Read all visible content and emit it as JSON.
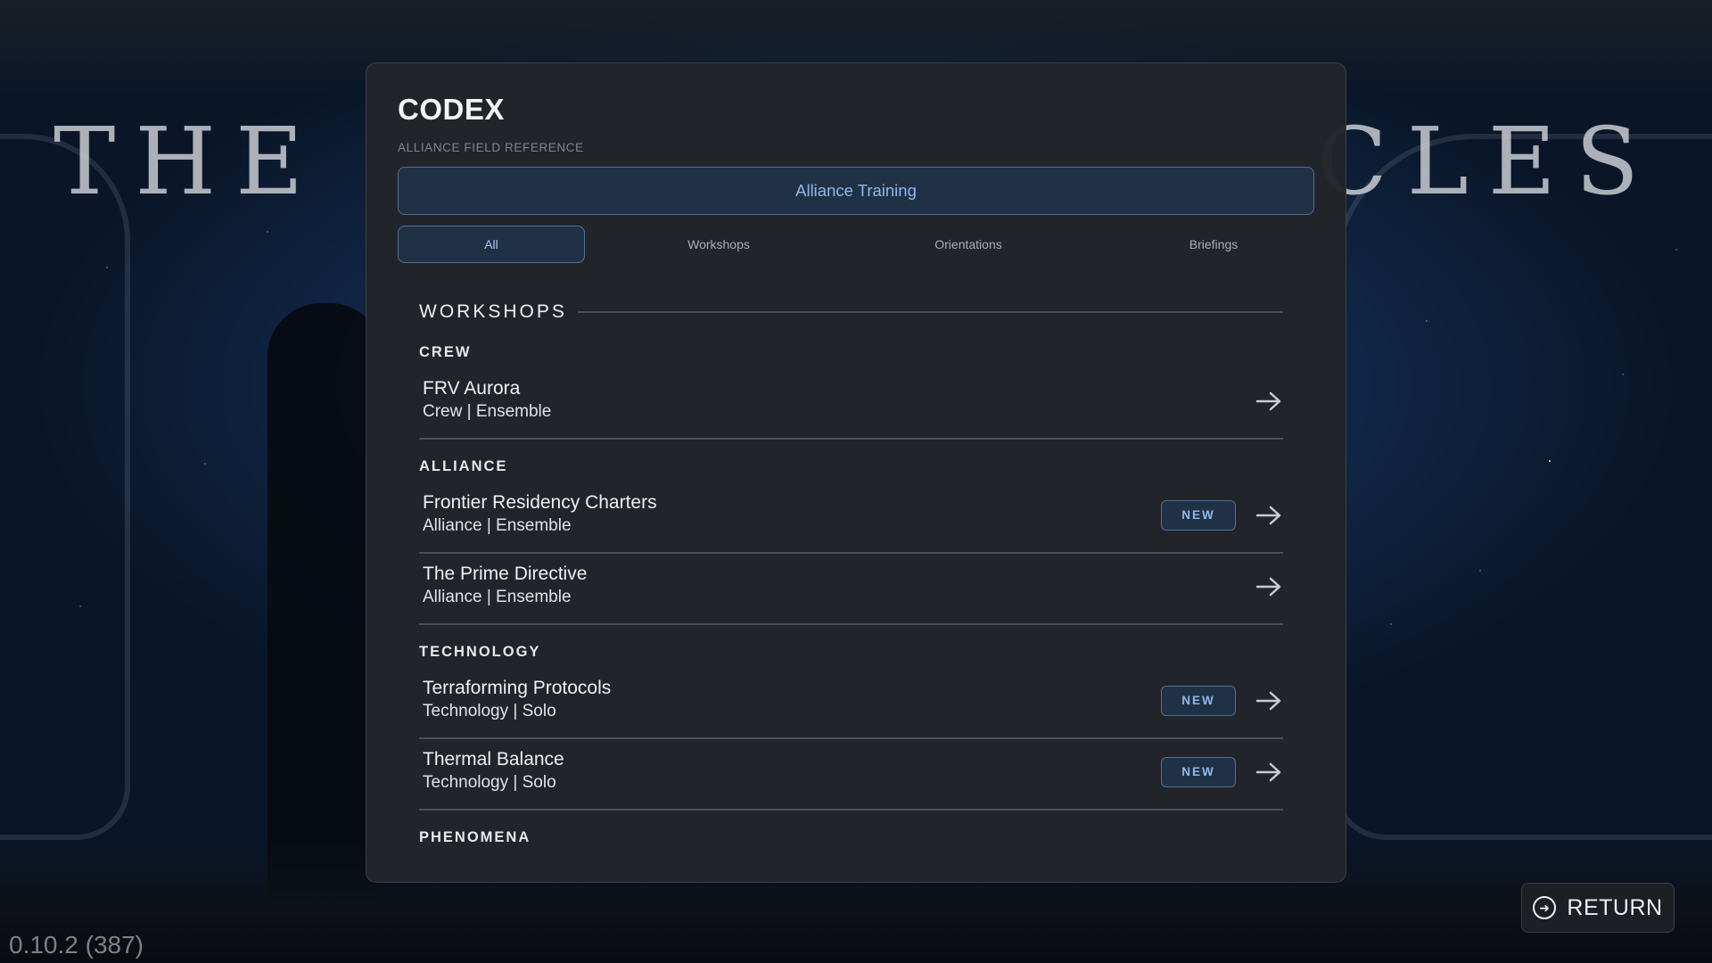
{
  "background": {
    "title_left": "THE",
    "title_right": "CLES",
    "version": "0.10.2 (387)"
  },
  "return_button": {
    "label": "RETURN",
    "icon": "arrow-right-circle-icon"
  },
  "panel": {
    "title": "CODEX",
    "subtitle": "ALLIANCE FIELD REFERENCE",
    "training_button": "Alliance Training",
    "tabs": [
      {
        "label": "All",
        "active": true
      },
      {
        "label": "Workshops",
        "active": false
      },
      {
        "label": "Orientations",
        "active": false
      },
      {
        "label": "Briefings",
        "active": false
      }
    ],
    "section": {
      "title": "WORKSHOPS",
      "groups": [
        {
          "label": "CREW",
          "items": [
            {
              "name": "FRV Aurora",
              "meta": "Crew | Ensemble",
              "new": false
            }
          ]
        },
        {
          "label": "ALLIANCE",
          "items": [
            {
              "name": "Frontier Residency Charters",
              "meta": "Alliance | Ensemble",
              "new": true
            },
            {
              "name": "The Prime Directive",
              "meta": "Alliance | Ensemble",
              "new": false
            }
          ]
        },
        {
          "label": "TECHNOLOGY",
          "items": [
            {
              "name": "Terraforming Protocols",
              "meta": "Technology | Solo",
              "new": true
            },
            {
              "name": "Thermal Balance",
              "meta": "Technology | Solo",
              "new": true
            }
          ]
        },
        {
          "label": "PHENOMENA",
          "items": []
        }
      ]
    },
    "new_badge": "NEW"
  },
  "colors": {
    "accent": "#8fb8ea",
    "accent_bg": "#203146",
    "accent_border": "#4d6f9a",
    "panel_bg": "#222529"
  }
}
